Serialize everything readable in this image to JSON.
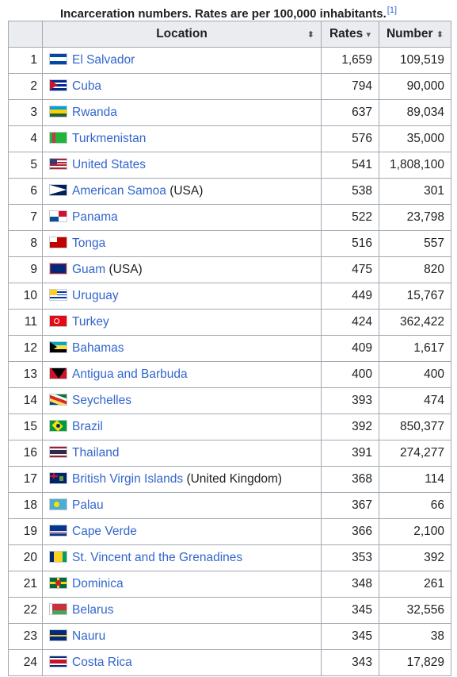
{
  "caption": {
    "title": "Incarceration numbers. Rates are per 100,000 inhabitants.",
    "ref": "[1]"
  },
  "headers": {
    "location": "Location",
    "rates": "Rates",
    "number": "Number",
    "sort_icon": "⬍",
    "sort_desc_icon": "▾"
  },
  "rows": [
    {
      "idx": "1",
      "country": "El Salvador",
      "suffix": "",
      "rate": "1,659",
      "number": "109,519",
      "flag": "sv-flag-icon",
      "colors": [
        "#0047ab",
        "#ffffff",
        "#0047ab"
      ],
      "pattern": "h3"
    },
    {
      "idx": "2",
      "country": "Cuba",
      "suffix": "",
      "rate": "794",
      "number": "90,000",
      "flag": "cu-flag-icon",
      "colors": [
        "#002a8f",
        "#ffffff",
        "#cf142b"
      ],
      "pattern": "stripes-tri"
    },
    {
      "idx": "3",
      "country": "Rwanda",
      "suffix": "",
      "rate": "637",
      "number": "89,034",
      "flag": "rw-flag-icon",
      "colors": [
        "#00a1de",
        "#fad201",
        "#20603d"
      ],
      "pattern": "h3-tall"
    },
    {
      "idx": "4",
      "country": "Turkmenistan",
      "suffix": "",
      "rate": "576",
      "number": "35,000",
      "flag": "tm-flag-icon",
      "colors": [
        "#1eb53a",
        "#ca3745"
      ],
      "pattern": "band-left"
    },
    {
      "idx": "5",
      "country": "United States",
      "suffix": "",
      "rate": "541",
      "number": "1,808,100",
      "flag": "us-flag-icon",
      "colors": [
        "#b22234",
        "#ffffff",
        "#3c3b6e"
      ],
      "pattern": "stripes-canton"
    },
    {
      "idx": "6",
      "country": "American Samoa",
      "suffix": " (USA)",
      "rate": "538",
      "number": "301",
      "flag": "as-flag-icon",
      "colors": [
        "#00205b",
        "#ffffff",
        "#bf0d3e"
      ],
      "pattern": "tri"
    },
    {
      "idx": "7",
      "country": "Panama",
      "suffix": "",
      "rate": "522",
      "number": "23,798",
      "flag": "pa-flag-icon",
      "colors": [
        "#ffffff",
        "#d21034",
        "#005293"
      ],
      "pattern": "quad"
    },
    {
      "idx": "8",
      "country": "Tonga",
      "suffix": "",
      "rate": "516",
      "number": "557",
      "flag": "to-flag-icon",
      "colors": [
        "#c10000",
        "#ffffff"
      ],
      "pattern": "canton"
    },
    {
      "idx": "9",
      "country": "Guam",
      "suffix": " (USA)",
      "rate": "475",
      "number": "820",
      "flag": "gu-flag-icon",
      "colors": [
        "#00297b",
        "#c62139"
      ],
      "pattern": "border"
    },
    {
      "idx": "10",
      "country": "Uruguay",
      "suffix": "",
      "rate": "449",
      "number": "15,767",
      "flag": "uy-flag-icon",
      "colors": [
        "#ffffff",
        "#0038a8",
        "#fcd116"
      ],
      "pattern": "stripes-sun"
    },
    {
      "idx": "11",
      "country": "Turkey",
      "suffix": "",
      "rate": "424",
      "number": "362,422",
      "flag": "tr-flag-icon",
      "colors": [
        "#e30a17",
        "#ffffff"
      ],
      "pattern": "crescent"
    },
    {
      "idx": "12",
      "country": "Bahamas",
      "suffix": "",
      "rate": "409",
      "number": "1,617",
      "flag": "bs-flag-icon",
      "colors": [
        "#00abc9",
        "#fae042",
        "#000000"
      ],
      "pattern": "h3-tri"
    },
    {
      "idx": "13",
      "country": "Antigua and Barbuda",
      "suffix": "",
      "rate": "400",
      "number": "400",
      "flag": "ag-flag-icon",
      "colors": [
        "#ce1126",
        "#000000",
        "#0072c6"
      ],
      "pattern": "vshape"
    },
    {
      "idx": "14",
      "country": "Seychelles",
      "suffix": "",
      "rate": "393",
      "number": "474",
      "flag": "sc-flag-icon",
      "colors": [
        "#003f87",
        "#fcd856",
        "#d62828",
        "#007a3d"
      ],
      "pattern": "rays"
    },
    {
      "idx": "15",
      "country": "Brazil",
      "suffix": "",
      "rate": "392",
      "number": "850,377",
      "flag": "br-flag-icon",
      "colors": [
        "#009c3b",
        "#ffdf00",
        "#002776"
      ],
      "pattern": "diamond"
    },
    {
      "idx": "16",
      "country": "Thailand",
      "suffix": "",
      "rate": "391",
      "number": "274,277",
      "flag": "th-flag-icon",
      "colors": [
        "#a51931",
        "#f4f5f8",
        "#2d2a4a"
      ],
      "pattern": "thai"
    },
    {
      "idx": "17",
      "country": "British Virgin Islands",
      "suffix": " (United Kingdom)",
      "rate": "368",
      "number": "114",
      "flag": "vg-flag-icon",
      "colors": [
        "#002469",
        "#cf142b",
        "#ffffff"
      ],
      "pattern": "ensign"
    },
    {
      "idx": "18",
      "country": "Palau",
      "suffix": "",
      "rate": "367",
      "number": "66",
      "flag": "pw-flag-icon",
      "colors": [
        "#4aadd6",
        "#ffde00"
      ],
      "pattern": "disc"
    },
    {
      "idx": "19",
      "country": "Cape Verde",
      "suffix": "",
      "rate": "366",
      "number": "2,100",
      "flag": "cv-flag-icon",
      "colors": [
        "#003893",
        "#ffffff",
        "#cf2027"
      ],
      "pattern": "cv"
    },
    {
      "idx": "20",
      "country": "St. Vincent and the Grenadines",
      "suffix": "",
      "rate": "353",
      "number": "392",
      "flag": "vc-flag-icon",
      "colors": [
        "#002674",
        "#fcd022",
        "#009e60"
      ],
      "pattern": "v3"
    },
    {
      "idx": "21",
      "country": "Dominica",
      "suffix": "",
      "rate": "348",
      "number": "261",
      "flag": "dm-flag-icon",
      "colors": [
        "#006b3f",
        "#fcd116",
        "#d41c30"
      ],
      "pattern": "cross"
    },
    {
      "idx": "22",
      "country": "Belarus",
      "suffix": "",
      "rate": "345",
      "number": "32,556",
      "flag": "by-flag-icon",
      "colors": [
        "#c8313e",
        "#4aa657",
        "#ffffff"
      ],
      "pattern": "by"
    },
    {
      "idx": "23",
      "country": "Nauru",
      "suffix": "",
      "rate": "345",
      "number": "38",
      "flag": "nr-flag-icon",
      "colors": [
        "#002b7f",
        "#ffc61e"
      ],
      "pattern": "nauru"
    },
    {
      "idx": "24",
      "country": "Costa Rica",
      "suffix": "",
      "rate": "343",
      "number": "17,829",
      "flag": "cr-flag-icon",
      "colors": [
        "#002b7f",
        "#ffffff",
        "#ce1126"
      ],
      "pattern": "cr"
    }
  ]
}
